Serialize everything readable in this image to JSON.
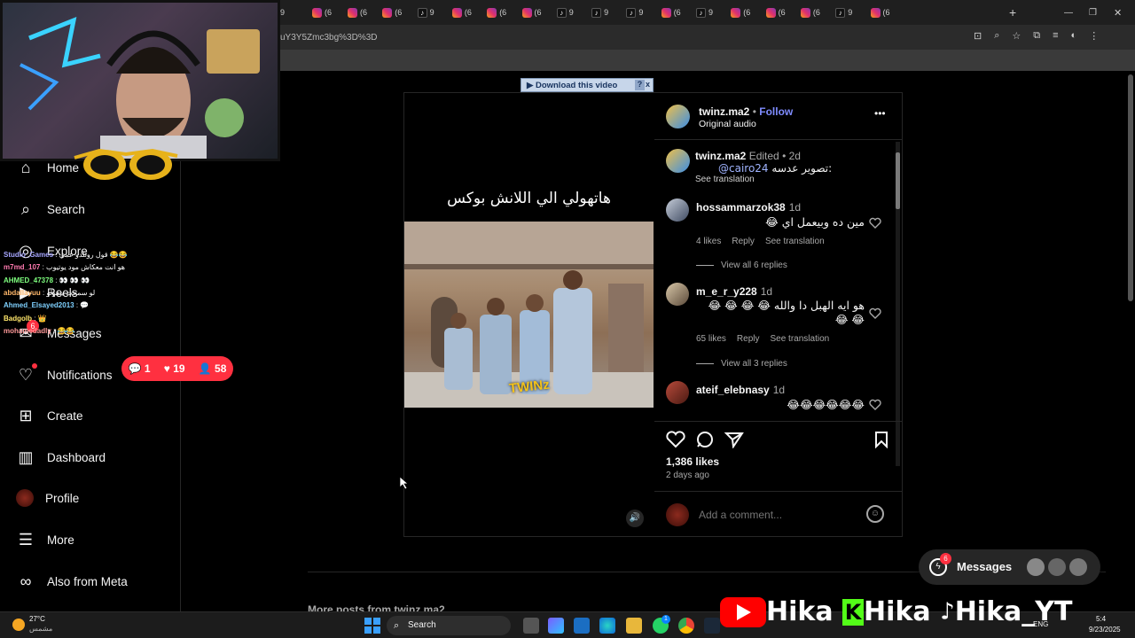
{
  "browser": {
    "tabs": [
      {
        "kind": "ig",
        "label": "(6"
      },
      {
        "kind": "ig",
        "label": "(6"
      },
      {
        "kind": "tt",
        "label": "9"
      },
      {
        "kind": "ig",
        "label": "(6"
      },
      {
        "kind": "ig",
        "label": "(6"
      },
      {
        "kind": "ig",
        "label": "(6"
      },
      {
        "kind": "tt",
        "label": "9"
      },
      {
        "kind": "tt",
        "label": "9"
      },
      {
        "kind": "tt",
        "label": "9"
      },
      {
        "kind": "ig",
        "label": "(6"
      },
      {
        "kind": "tt",
        "label": "9"
      },
      {
        "kind": "ig",
        "label": "(6"
      },
      {
        "kind": "ig",
        "label": "(6"
      },
      {
        "kind": "ig",
        "label": "(6"
      },
      {
        "kind": "tt",
        "label": "9"
      },
      {
        "kind": "ig",
        "label": "(6"
      }
    ],
    "first_tab_labels": [
      "9",
      "(6"
    ],
    "url_fragment": "uY3Y5Zmc3bg%3D%3D"
  },
  "sidebar": {
    "items": [
      {
        "name": "home",
        "label": "Home"
      },
      {
        "name": "search",
        "label": "Search"
      },
      {
        "name": "explore",
        "label": "Explore"
      },
      {
        "name": "reels",
        "label": "Reels"
      },
      {
        "name": "messages",
        "label": "Messages"
      },
      {
        "name": "notifications",
        "label": "Notifications"
      },
      {
        "name": "create",
        "label": "Create"
      },
      {
        "name": "dashboard",
        "label": "Dashboard"
      },
      {
        "name": "profile",
        "label": "Profile"
      },
      {
        "name": "more",
        "label": "More"
      },
      {
        "name": "meta",
        "label": "Also from Meta"
      }
    ],
    "messages_badge": "6"
  },
  "download_bar": {
    "label": "Download this video",
    "help": "?",
    "close": "x"
  },
  "video": {
    "caption": "هاتهولي الي اللانش بوكس",
    "sticker_text": "TWINz"
  },
  "post_header": {
    "username": "twinz.ma2",
    "dot": "•",
    "follow": "Follow",
    "audio": "Original audio",
    "more": "•••"
  },
  "caption_block": {
    "username": "twinz.ma2",
    "edited": "Edited",
    "dot": "•",
    "time": "2d",
    "text_prefix": "تصوير عدسه:",
    "mention": "@cairo24",
    "see_translation": "See translation"
  },
  "comments": [
    {
      "username": "hossammarzok38",
      "time": "1d",
      "text": "مين ده وبيعمل اي 😂",
      "likes": "4 likes",
      "reply": "Reply",
      "see_translation": "See translation",
      "view_replies": "View all 6 replies"
    },
    {
      "username": "m_e_r_y228",
      "time": "1d",
      "text": "هو ايه الهبل دا والله 😂 😂 😂 😂 😂 😂",
      "likes": "65 likes",
      "reply": "Reply",
      "see_translation": "See translation",
      "view_replies": "View all 3 replies"
    },
    {
      "username": "ateif_elebnasy",
      "time": "1d",
      "text": "😂😂😂😂😂😂"
    }
  ],
  "actions": {
    "likes": "1,386 likes",
    "age": "2 days ago",
    "add_comment_placeholder": "Add a comment..."
  },
  "overlay": {
    "stats": {
      "comments": "1",
      "likes": "19",
      "viewers": "58"
    },
    "chat": [
      {
        "user": "Studio_Games",
        "text": "قول روئلدو عمي 😂😂"
      },
      {
        "user": "m7md_107",
        "text": "هو انت معكاش مود يوتيوب"
      },
      {
        "user": "AHMED_47378",
        "text": "👀 👀 👀"
      },
      {
        "user": "abdallayuu",
        "text": "لو سمحت بنقولو"
      },
      {
        "user": "Ahmed_Elsayed2013",
        "text": "💬"
      },
      {
        "user": "Badgolb",
        "text": "👑"
      },
      {
        "user": "mohamedadly",
        "text": "😂😂"
      }
    ],
    "branding": [
      "Hika",
      "Hika",
      "Hika_YT"
    ]
  },
  "messages_pill": {
    "label": "Messages",
    "badge": "6"
  },
  "taskbar": {
    "weather_temp": "27°C",
    "weather_desc": "مشمس",
    "search_label": "Search",
    "lang": "ENG",
    "time": "5:4",
    "date": "9/23/2025",
    "whatsapp_badge": "1"
  },
  "page_footer": {
    "more_posts": "More posts from twinz.ma2"
  },
  "colors": {
    "accent": "#0095f6",
    "follow": "#7f8cff",
    "live_red": "#ff3040",
    "mention": "#a0b4ff"
  }
}
